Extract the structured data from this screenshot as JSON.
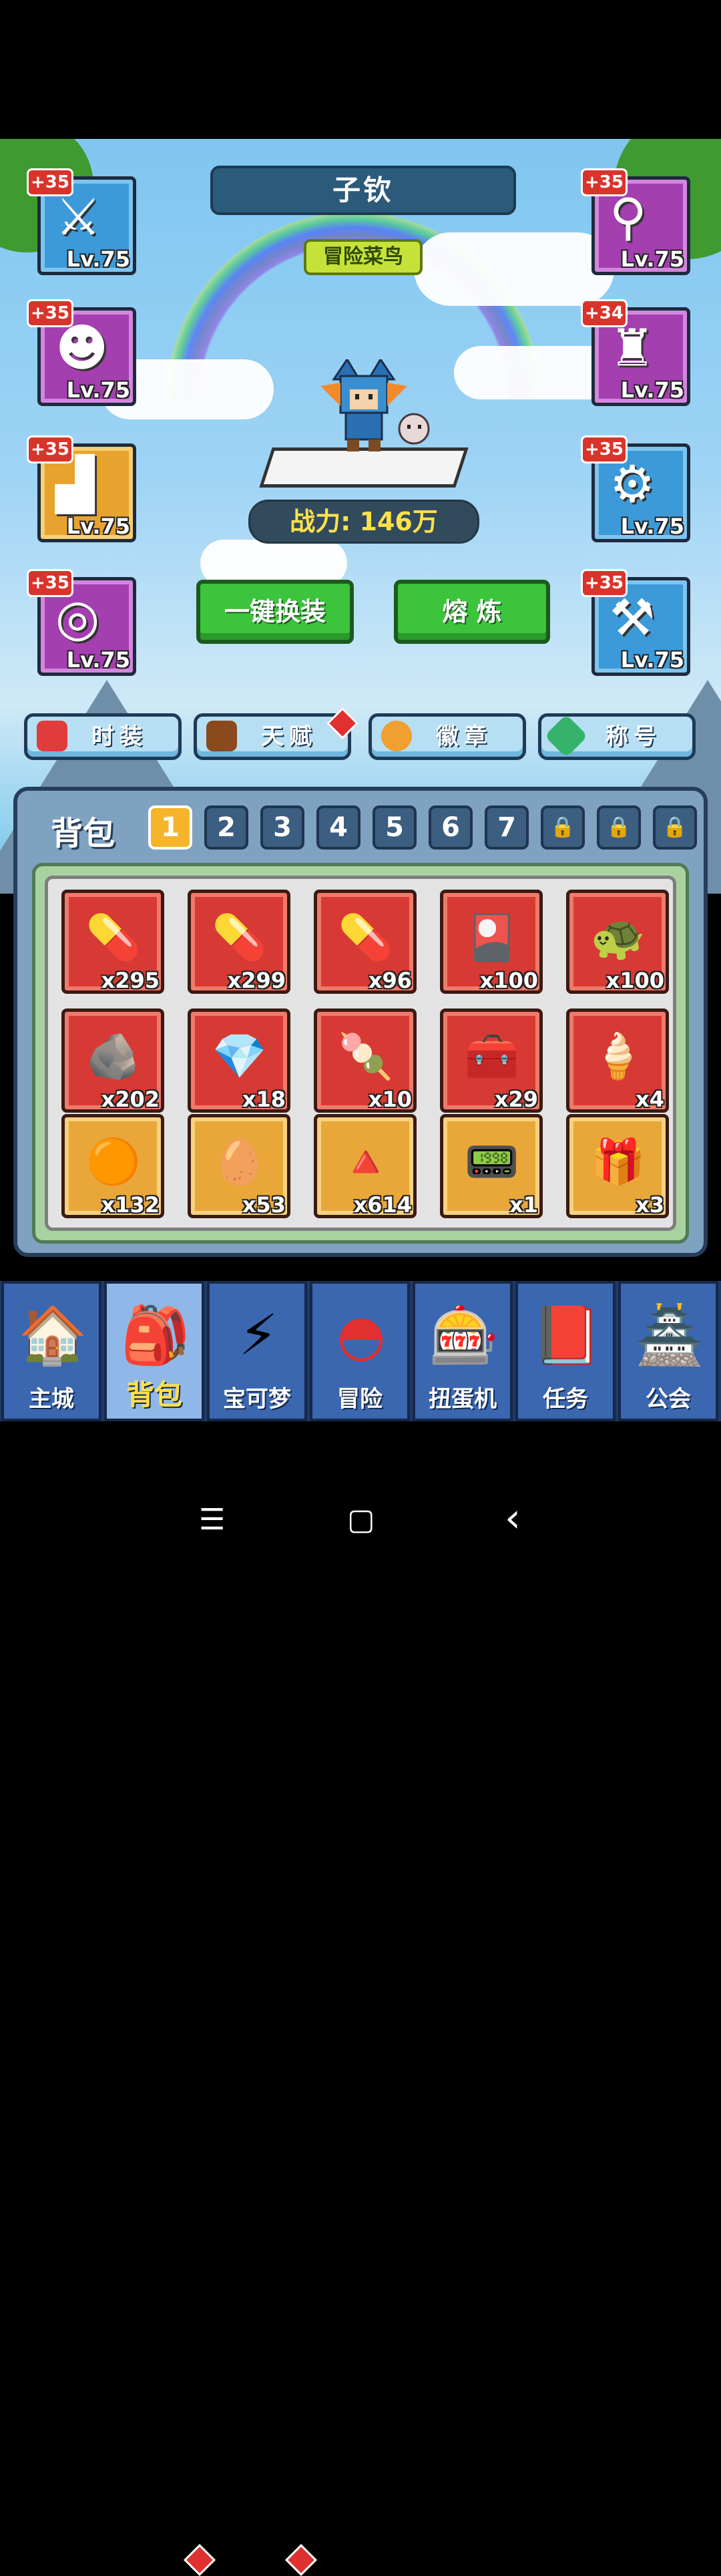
{
  "player": {
    "name": "子钦",
    "rank": "冒险菜鸟",
    "power": "战力: 146万"
  },
  "equipment": {
    "left": [
      {
        "plus": "+35",
        "level": "Lv.75",
        "glyph": "⚔",
        "icon": "sword-icon",
        "color": "blue"
      },
      {
        "plus": "+35",
        "level": "Lv.75",
        "glyph": "☻",
        "icon": "helmet-icon",
        "color": "purple"
      },
      {
        "plus": "+35",
        "level": "Lv.75",
        "glyph": "▟",
        "icon": "boots-icon",
        "color": "orange"
      },
      {
        "plus": "+35",
        "level": "Lv.75",
        "glyph": "◎",
        "icon": "ring-icon",
        "color": "purple"
      }
    ],
    "right": [
      {
        "plus": "+35",
        "level": "Lv.75",
        "glyph": "⚲",
        "icon": "wand-icon",
        "color": "purple"
      },
      {
        "plus": "+34",
        "level": "Lv.75",
        "glyph": "♜",
        "icon": "robe-icon",
        "color": "purple"
      },
      {
        "plus": "+35",
        "level": "Lv.75",
        "glyph": "⚙",
        "icon": "armor-icon",
        "color": "blue"
      },
      {
        "plus": "+35",
        "level": "Lv.75",
        "glyph": "⚒",
        "icon": "axe-icon",
        "color": "blue"
      }
    ]
  },
  "actions": {
    "equip_all": "一键换装",
    "smelt": "熔 炼"
  },
  "features": [
    {
      "label": "时装",
      "icon": "fashion-icon",
      "color": "#e23b3b"
    },
    {
      "label": "天赋",
      "icon": "talent-book-icon",
      "color": "#8a4a1e",
      "badge": true
    },
    {
      "label": "徽章",
      "icon": "badge-icon",
      "color": "#f0a030"
    },
    {
      "label": "称号",
      "icon": "title-gem-icon",
      "color": "#36b36a"
    }
  ],
  "bag": {
    "title": "背包",
    "pages": [
      "1",
      "2",
      "3",
      "4",
      "5",
      "6",
      "7",
      "🔒",
      "🔒",
      "🔒"
    ],
    "active_page": "1",
    "items": [
      {
        "count": "x295",
        "glyph": "💊",
        "icon": "pink-capsule-icon",
        "bg": "red"
      },
      {
        "count": "x299",
        "glyph": "💊",
        "icon": "yellow-capsule-icon",
        "bg": "red"
      },
      {
        "count": "x96",
        "glyph": "💊",
        "icon": "blue-capsule-icon",
        "bg": "red"
      },
      {
        "count": "x100",
        "glyph": "🎴",
        "icon": "cards-icon",
        "bg": "red"
      },
      {
        "count": "x100",
        "glyph": "🐢",
        "icon": "turtle-icon",
        "bg": "red"
      },
      {
        "count": "x202",
        "glyph": "🪨",
        "icon": "ore-icon",
        "bg": "red"
      },
      {
        "count": "x18",
        "glyph": "💎",
        "icon": "blue-gem-icon",
        "bg": "red"
      },
      {
        "count": "x10",
        "glyph": "🍡",
        "icon": "dango-plate-icon",
        "bg": "red"
      },
      {
        "count": "x29",
        "glyph": "🧰",
        "icon": "red-chest-icon",
        "bg": "red"
      },
      {
        "count": "x4",
        "glyph": "🍦",
        "icon": "ice-cream-icon",
        "bg": "red"
      },
      {
        "count": "x132",
        "glyph": "🟠",
        "icon": "fire-orb-icon",
        "bg": "gold"
      },
      {
        "count": "x53",
        "glyph": "🥚",
        "icon": "green-egg-icon",
        "bg": "gold"
      },
      {
        "count": "x614",
        "glyph": "🔺",
        "icon": "red-crystal-icon",
        "bg": "gold"
      },
      {
        "count": "x1",
        "glyph": "📟",
        "icon": "device-icon",
        "bg": "gold"
      },
      {
        "count": "x3",
        "glyph": "🎁",
        "icon": "mystery-box-icon",
        "bg": "gold"
      }
    ]
  },
  "nav": [
    {
      "label": "主城",
      "icon": "main-city-icon",
      "glyph": "🏠"
    },
    {
      "label": "背包",
      "icon": "backpack-icon",
      "glyph": "🎒",
      "active": true,
      "badge": true
    },
    {
      "label": "宝可梦",
      "icon": "pikachu-icon",
      "glyph": "⚡",
      "badge": true
    },
    {
      "label": "冒险",
      "icon": "pokeball-icon",
      "glyph": "◓"
    },
    {
      "label": "扭蛋机",
      "icon": "gacha-machine-icon",
      "glyph": "🎰"
    },
    {
      "label": "任务",
      "icon": "quest-icon",
      "glyph": "📕"
    },
    {
      "label": "公会",
      "icon": "guild-icon",
      "glyph": "🏯"
    }
  ],
  "system_nav": {
    "menu": "☰",
    "home": "▢",
    "back": "‹"
  },
  "colors": {
    "accent_green": "#3cc43c",
    "power_text": "#ffe14a",
    "nav_bg": "#3a67b0"
  }
}
